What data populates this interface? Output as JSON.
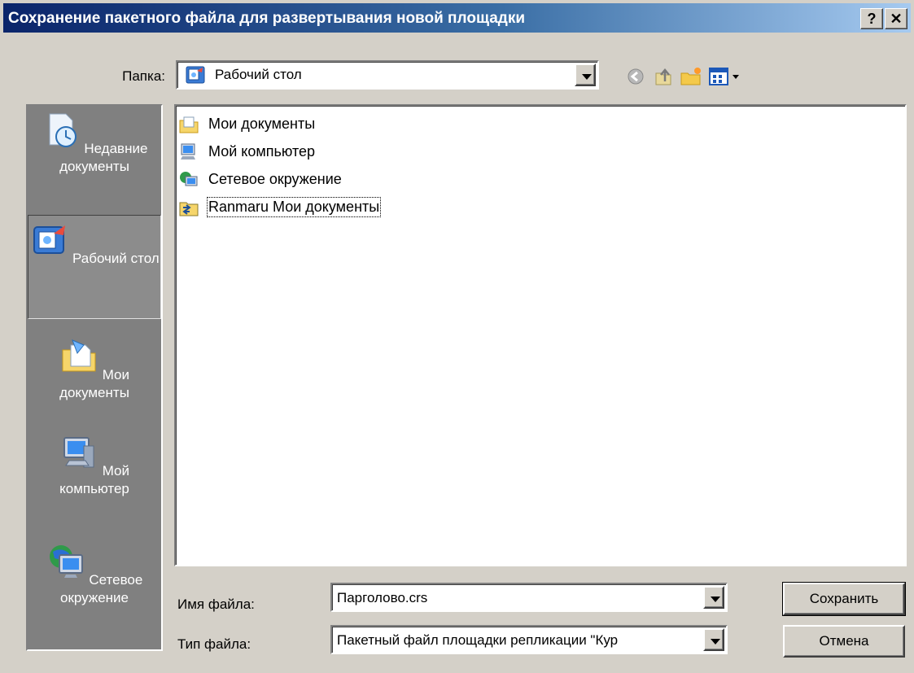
{
  "window": {
    "title": "Сохранение пакетного файла для развертывания новой площадки",
    "help_label": "?",
    "close_label": "✕"
  },
  "lookin": {
    "label": "Папка:",
    "value": "Рабочий стол",
    "icon": "desktop-icon"
  },
  "toolbar": {
    "back_icon": "back-icon",
    "up_icon": "up-folder-icon",
    "new_folder_icon": "new-folder-icon",
    "view_icon": "view-menu-icon"
  },
  "places": [
    {
      "label": "Недавние документы",
      "icon": "recent-documents-icon"
    },
    {
      "label": "Рабочий стол",
      "icon": "desktop-icon",
      "selected": true
    },
    {
      "label": "Мои документы",
      "icon": "my-documents-icon"
    },
    {
      "label": "Мой компьютер",
      "icon": "my-computer-icon"
    },
    {
      "label": "Сетевое окружение",
      "icon": "network-icon"
    }
  ],
  "files": [
    {
      "label": "Мои документы",
      "icon": "my-documents-icon"
    },
    {
      "label": "Мой компьютер",
      "icon": "my-computer-icon"
    },
    {
      "label": "Сетевое окружение",
      "icon": "network-icon"
    },
    {
      "label": "Ranmaru Мои документы",
      "icon": "shared-folder-icon",
      "focused": true
    }
  ],
  "filename": {
    "label": "Имя файла:",
    "value": "Парголово.crs"
  },
  "filetype": {
    "label": "Тип файла:",
    "value": "Пакетный файл площадки репликации \"Кур"
  },
  "buttons": {
    "save": "Сохранить",
    "cancel": "Отмена"
  },
  "colors": {
    "titlebar_start": "#0a246a",
    "titlebar_end": "#a6caf0",
    "face": "#d4d0c8",
    "places_bg": "#808080"
  }
}
